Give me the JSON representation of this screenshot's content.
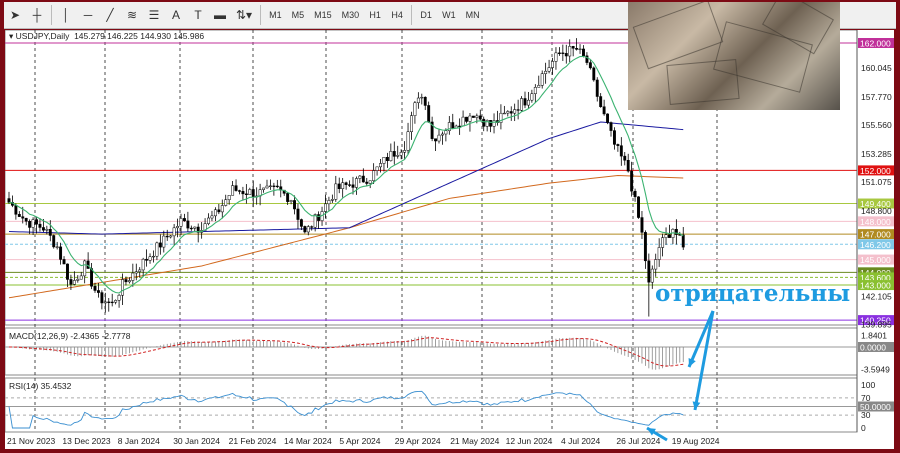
{
  "toolbar": {
    "tools": [
      "cursor-icon",
      "crosshair-icon",
      "vertical-line-icon",
      "horizontal-line-icon",
      "trendline-icon",
      "fibonacci-icon",
      "fibo-channel-icon",
      "text-icon",
      "text-label-icon",
      "rectangle-icon",
      "shapes-icon"
    ],
    "text_tool": "A",
    "timeframes": [
      "M1",
      "M5",
      "M15",
      "M30",
      "H1",
      "H4",
      "D1",
      "W1",
      "MN"
    ]
  },
  "chart": {
    "symbol": "USDJPY,Daily",
    "ohlc": "145.279 146.225 144.930 145.986",
    "price_axis": [
      "160.045",
      "157.770",
      "155.560",
      "153.285",
      "151.075",
      "148.800",
      "142.105",
      "139.895"
    ],
    "levels": [
      {
        "value": 162.0,
        "label": "162.000",
        "color": "#c0309a"
      },
      {
        "value": 152.0,
        "label": "152.000",
        "color": "#e01010"
      },
      {
        "value": 149.4,
        "label": "149.400",
        "color": "#a8c840"
      },
      {
        "value": 148.0,
        "label": "148.000",
        "color": "#f4c0cc"
      },
      {
        "value": 147.0,
        "label": "147.000",
        "color": "#b08a20"
      },
      {
        "value": 146.2,
        "label": "146.200",
        "color": "#80c8e8"
      },
      {
        "value": 145.0,
        "label": "145.000",
        "color": "#f4c0cc"
      },
      {
        "value": 144.0,
        "label": "144.000",
        "color": "#6a8a20"
      },
      {
        "value": 143.6,
        "label": "143.600",
        "color": "#8ac030"
      },
      {
        "value": 143.0,
        "label": "143.000",
        "color": "#8ac030"
      },
      {
        "value": 140.25,
        "label": "140.250",
        "color": "#8a30e0"
      }
    ],
    "price_path": [
      [
        0,
        149.5
      ],
      [
        5,
        148
      ],
      [
        10,
        147.5
      ],
      [
        14,
        146
      ],
      [
        18,
        143
      ],
      [
        22,
        144.5
      ],
      [
        26,
        142
      ],
      [
        30,
        141.5
      ],
      [
        33,
        143
      ],
      [
        38,
        144.5
      ],
      [
        45,
        146.5
      ],
      [
        50,
        148
      ],
      [
        55,
        147.5
      ],
      [
        60,
        148.5
      ],
      [
        65,
        150.5
      ],
      [
        72,
        150.2
      ],
      [
        78,
        150.5
      ],
      [
        82,
        149.8
      ],
      [
        86,
        147
      ],
      [
        90,
        148.5
      ],
      [
        95,
        150.5
      ],
      [
        105,
        151.5
      ],
      [
        110,
        153
      ],
      [
        115,
        154
      ],
      [
        119,
        158
      ],
      [
        121,
        157.5
      ],
      [
        123,
        154.5
      ],
      [
        128,
        155.5
      ],
      [
        135,
        156.5
      ],
      [
        140,
        155.5
      ],
      [
        145,
        156.5
      ],
      [
        150,
        157.5
      ],
      [
        155,
        159.5
      ],
      [
        160,
        161.2
      ],
      [
        165,
        161.5
      ],
      [
        168,
        160.5
      ],
      [
        172,
        157
      ],
      [
        176,
        154
      ],
      [
        180,
        152
      ],
      [
        184,
        147
      ],
      [
        186,
        143
      ],
      [
        189,
        146
      ],
      [
        193,
        147.5
      ],
      [
        196,
        145.98
      ]
    ],
    "ma_slow_blue": [
      [
        0,
        147.2
      ],
      [
        27,
        147
      ],
      [
        99,
        147.5
      ],
      [
        128,
        151
      ],
      [
        157,
        154.5
      ],
      [
        172,
        155.8
      ],
      [
        196,
        155.2
      ]
    ],
    "ma_slow_orange": [
      [
        0,
        142
      ],
      [
        56,
        144.5
      ],
      [
        99,
        147.5
      ],
      [
        128,
        149.8
      ],
      [
        157,
        151
      ],
      [
        177,
        151.6
      ],
      [
        196,
        151.4
      ]
    ]
  },
  "macd": {
    "label": "MACD(12,26,9) -2.4365 -2.7778",
    "axis": [
      "1.8401",
      "0.0000",
      "-3.5949"
    ]
  },
  "rsi": {
    "label": "RSI(14) 35.4532",
    "axis": [
      "100",
      "70",
      "50.0000",
      "30",
      "0"
    ]
  },
  "dates": [
    "21 Nov 2023",
    "13 Dec 2023",
    "8 Jan 2024",
    "30 Jan 2024",
    "21 Feb 2024",
    "14 Mar 2024",
    "5 Apr 2024",
    "29 Apr 2024",
    "21 May 2024",
    "12 Jun 2024",
    "4 Jul 2024",
    "26 Jul 2024",
    "19 Aug 2024"
  ],
  "annotation": "отрицательны",
  "colors": {
    "frame": "#7d0a14",
    "annotation": "#1e9be0"
  }
}
